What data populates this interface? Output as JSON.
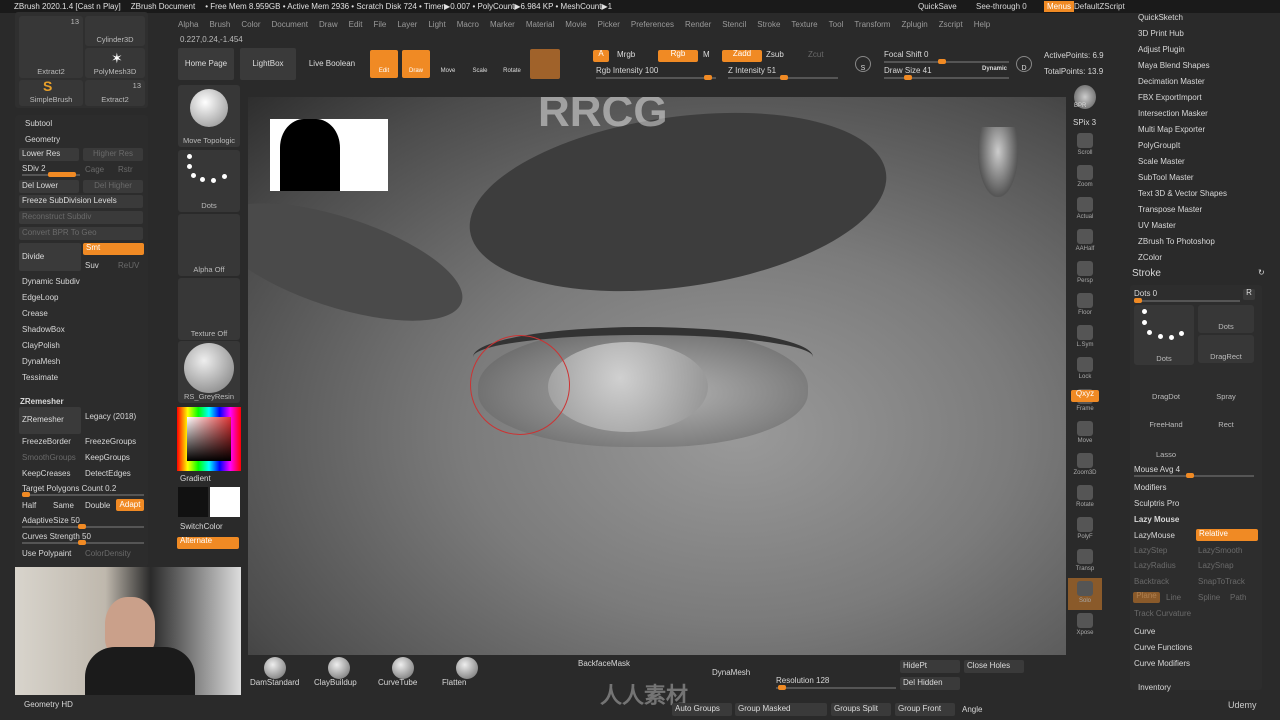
{
  "titlebar": {
    "app": "ZBrush 2020.1.4 [Cast n Play]",
    "doc": "ZBrush Document",
    "stats": "• Free Mem 8.959GB • Active Mem 2936 • Scratch Disk 724 • Timer▶0.007 • PolyCount▶6.984 KP • MeshCount▶1",
    "quicksave": "QuickSave",
    "seethrough": "See-through  0",
    "menus": "Menus",
    "script": "DefaultZScript"
  },
  "menu": [
    "Alpha",
    "Brush",
    "Color",
    "Document",
    "Draw",
    "Edit",
    "File",
    "Layer",
    "Light",
    "Macro",
    "Marker",
    "Material",
    "Movie",
    "Picker",
    "Preferences",
    "Render",
    "Stencil",
    "Stroke",
    "Texture",
    "Tool",
    "Transform",
    "Zplugin",
    "Zscript",
    "Help"
  ],
  "coords": "0.227,0.24,-1.454",
  "tools": {
    "t1": "Extract2",
    "t1_count": "13",
    "t2": "Cylinder3D",
    "t3": "PolyMesh3D",
    "t4": "SimpleBrush",
    "t5": "Extract2",
    "t5_count": "13"
  },
  "topshelf": {
    "home": "Home Page",
    "lightbox": "LightBox",
    "liveboolean": "Live Boolean",
    "edit": "Edit",
    "draw": "Draw",
    "move": "Move",
    "scale": "Scale",
    "rotate": "Rotate",
    "a": "A",
    "mrgb": "Mrgb",
    "rgb": "Rgb",
    "m": "M",
    "zadd": "Zadd",
    "zsub": "Zsub",
    "zcut": "Zcut",
    "rgb_intensity": "Rgb Intensity 100",
    "z_intensity": "Z Intensity 51",
    "focal_shift": "Focal Shift 0",
    "draw_size": "Draw Size 41",
    "dynamic": "Dynamic",
    "active_points": "ActivePoints: 6.9",
    "total_points": "TotalPoints: 13.9",
    "s": "S",
    "d": "D"
  },
  "leftshelf": {
    "brush": "Move Topologic",
    "stroke": "Dots",
    "alpha": "Alpha Off",
    "texture": "Texture Off",
    "material": "RS_GreyResin",
    "gradient": "Gradient",
    "switch": "SwitchColor",
    "alternate": "Alternate"
  },
  "geometry": {
    "subtool": "Subtool",
    "title": "Geometry",
    "lower": "Lower Res",
    "higher": "Higher Res",
    "sdiv": "SDiv 2",
    "cage": "Cage",
    "rstr": "Rstr",
    "dellower": "Del Lower",
    "delhigher": "Del Higher",
    "freeze": "Freeze SubDivision Levels",
    "reconstruct": "Reconstruct Subdiv",
    "convert": "Convert BPR To Geo",
    "divide": "Divide",
    "smt": "Smt",
    "suv": "Suv",
    "reuv": "ReUV",
    "items": [
      "Dynamic Subdiv",
      "EdgeLoop",
      "Crease",
      "ShadowBox",
      "ClayPolish",
      "DynaMesh",
      "Tessimate"
    ],
    "zremesher_hdr": "ZRemesher",
    "zremesher": "ZRemesher",
    "legacy": "Legacy (2018)",
    "freezeborder": "FreezeBorder",
    "freezegroups": "FreezeGroups",
    "smoothgroups": "SmoothGroups",
    "keepgroups": "KeepGroups",
    "keepcreases": "KeepCreases",
    "detectedges": "DetectEdges",
    "target": "Target Polygons Count 0.2",
    "half": "Half",
    "same": "Same",
    "double": "Double",
    "adapt": "Adapt",
    "adaptive": "AdaptiveSize 50",
    "curves": "Curves Strength 50",
    "polypaint": "Use Polypaint",
    "colordensity": "ColorDensity",
    "geometryhd": "Geometry HD"
  },
  "plugins": [
    "QuickSketch",
    "3D Print Hub",
    "Adjust Plugin",
    "Maya Blend Shapes",
    "Decimation Master",
    "FBX ExportImport",
    "Intersection Masker",
    "Multi Map Exporter",
    "PolyGroupIt",
    "Scale Master",
    "SubTool Master",
    "Text 3D & Vector Shapes",
    "Transpose Master",
    "UV Master",
    "ZBrush To Photoshop",
    "ZColor"
  ],
  "stroke": {
    "title": "Stroke",
    "dots": "Dots  0",
    "r": "R",
    "main": "Dots",
    "types": [
      "Dots",
      "DragRect",
      "DragDot",
      "Spray",
      "FreeHand",
      "Rect",
      "Lasso"
    ],
    "mouseavg": "Mouse Avg 4",
    "modifiers": "Modifiers",
    "sculptris": "Sculptris Pro",
    "lazy": "Lazy Mouse",
    "lazymouse": "LazyMouse",
    "relative": "Relative",
    "lazystep": "LazyStep",
    "lazysmooth": "LazySmooth",
    "lazyradius": "LazyRadius",
    "lazysnap": "LazySnap",
    "backtrack": "Backtrack",
    "snaptotrack": "SnapToTrack",
    "plane": "Plane",
    "line": "Line",
    "spline": "Spline",
    "path": "Path",
    "trackcurv": "Track Curvature",
    "curve": "Curve",
    "curvefn": "Curve Functions",
    "curvemod": "Curve Modifiers",
    "inventory": "Inventory"
  },
  "rshelf": {
    "bpr": "BPR",
    "spix": "SPix 3",
    "items": [
      "Scroll",
      "Zoom",
      "Actual",
      "AAHalf",
      "Persp",
      "Floor",
      "L.Sym",
      "Lock",
      "Frame",
      "Move",
      "Zoom3D",
      "Rotate",
      "PolyF",
      "Transp",
      "Solo",
      "Xpose"
    ],
    "xyz": "Qxyz"
  },
  "bottom": {
    "brushes": [
      "DamStandard",
      "ClayBuildup",
      "CurveTube",
      "Flatten"
    ],
    "backface": "BackfaceMask",
    "dynamesh": "DynaMesh",
    "resolution": "Resolution 128",
    "hidepts": "HidePt",
    "closeholes": "Close Holes",
    "delhidden": "Del Hidden",
    "autogroups": "Auto Groups",
    "groupmasked": "Group Masked",
    "groupssplit": "Groups Split",
    "groupfront": "Group Front",
    "angle": "Angle"
  },
  "watermark": {
    "top": "RRCG",
    "udemy": "Udemy",
    "site": "人人素材"
  },
  "colors": {
    "accent": "#f08a24",
    "panel": "#2f2f2f"
  }
}
